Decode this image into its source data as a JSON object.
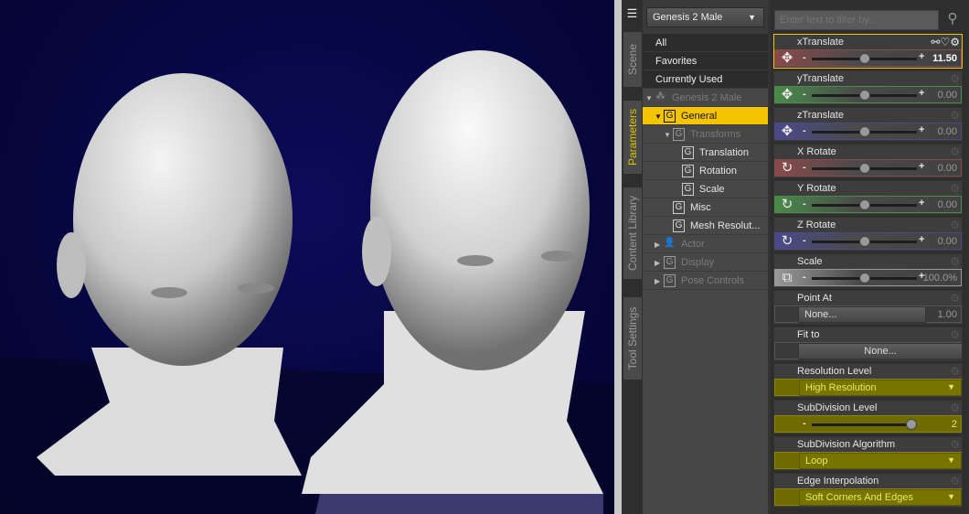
{
  "tabs": [
    {
      "label": "Scene",
      "active": false
    },
    {
      "label": "Parameters",
      "active": true
    },
    {
      "label": "Content Library",
      "active": false
    },
    {
      "label": "Tool Settings",
      "active": false
    }
  ],
  "tree": {
    "figure_select": "Genesis 2 Male",
    "categories": [
      "All",
      "Favorites",
      "Currently Used"
    ],
    "items": [
      {
        "label": "Genesis 2 Male",
        "level": 0,
        "expand": "down",
        "icon": "figure",
        "dim": true
      },
      {
        "label": "General",
        "level": 1,
        "expand": "down",
        "icon": "G",
        "selected": true
      },
      {
        "label": "Transforms",
        "level": 2,
        "expand": "down",
        "icon": "G",
        "dim": true
      },
      {
        "label": "Translation",
        "level": 3,
        "icon": "G"
      },
      {
        "label": "Rotation",
        "level": 3,
        "icon": "G"
      },
      {
        "label": "Scale",
        "level": 3,
        "icon": "G"
      },
      {
        "label": "Misc",
        "level": 2,
        "icon": "G"
      },
      {
        "label": "Mesh Resolut...",
        "level": 2,
        "icon": "G"
      },
      {
        "label": "Actor",
        "level": 1,
        "expand": "right",
        "icon": "person",
        "dim": true
      },
      {
        "label": "Display",
        "level": 1,
        "expand": "right",
        "icon": "G",
        "dim": true
      },
      {
        "label": "Pose Controls",
        "level": 1,
        "expand": "right",
        "icon": "G",
        "dim": true
      }
    ]
  },
  "filter": {
    "placeholder": "Enter text to filter by..."
  },
  "params": [
    {
      "label": "xTranslate",
      "type": "slider",
      "value": "11.50",
      "color": "#8a4a4a",
      "icon": "move",
      "active": true,
      "pos": 0.5
    },
    {
      "label": "yTranslate",
      "type": "slider",
      "value": "0.00",
      "color": "#4a8a4a",
      "icon": "move",
      "pos": 0.5
    },
    {
      "label": "zTranslate",
      "type": "slider",
      "value": "0.00",
      "color": "#4a4a8a",
      "icon": "move",
      "pos": 0.5
    },
    {
      "label": "X Rotate",
      "type": "slider",
      "value": "0.00",
      "color": "#8a4a4a",
      "icon": "rotate",
      "pos": 0.5
    },
    {
      "label": "Y Rotate",
      "type": "slider",
      "value": "0.00",
      "color": "#4a8a4a",
      "icon": "rotate",
      "pos": 0.5
    },
    {
      "label": "Z Rotate",
      "type": "slider",
      "value": "0.00",
      "color": "#4a4a8a",
      "icon": "rotate",
      "pos": 0.5
    },
    {
      "label": "Scale",
      "type": "slider",
      "value": "100.0%",
      "color": "#999999",
      "icon": "scale",
      "pos": 0.5
    },
    {
      "label": "Point At",
      "type": "nodebtn",
      "button": "None...",
      "value": "1.00"
    },
    {
      "label": "Fit to",
      "type": "button",
      "button": "None..."
    },
    {
      "label": "Resolution Level",
      "type": "dropdown",
      "value": "High Resolution"
    },
    {
      "label": "SubDivision Level",
      "type": "yslider",
      "value": "2",
      "pos": 0.95
    },
    {
      "label": "SubDivision Algorithm",
      "type": "dropdown",
      "value": "Loop"
    },
    {
      "label": "Edge Interpolation",
      "type": "dropdown",
      "value": "Soft Corners And Edges"
    }
  ]
}
